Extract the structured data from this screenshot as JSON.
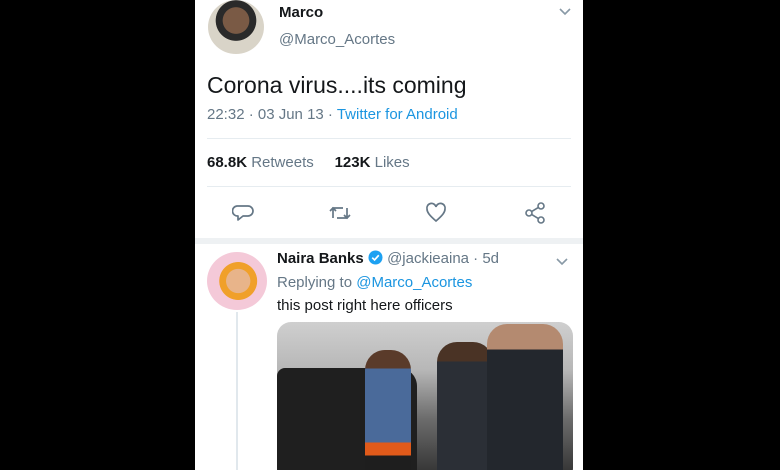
{
  "tweet": {
    "author_name": "Marco",
    "handle": "@Marco_Acortes",
    "text": "Corona virus....its coming",
    "meta_time_date": "22:32 · 03 Jun 13 · ",
    "meta_source": "Twitter for Android",
    "retweets_count": "68.8K",
    "retweets_label": "Retweets",
    "likes_count": "123K",
    "likes_label": "Likes",
    "actions": {
      "reply_icon": "reply-icon",
      "retweet_icon": "retweet-icon",
      "like_icon": "heart-icon",
      "share_icon": "share-icon"
    }
  },
  "reply": {
    "author_name": "Naira Banks",
    "verified_icon": "verified-badge-icon",
    "handle_time": "@jackieaina · 5d",
    "replying_prefix": "Replying to ",
    "replying_to": "@Marco_Acortes",
    "text": "this post right here officers"
  },
  "colors": {
    "background": "#000000",
    "card": "#ffffff",
    "link_blue": "#1b95e0",
    "muted_gray": "#657786"
  }
}
